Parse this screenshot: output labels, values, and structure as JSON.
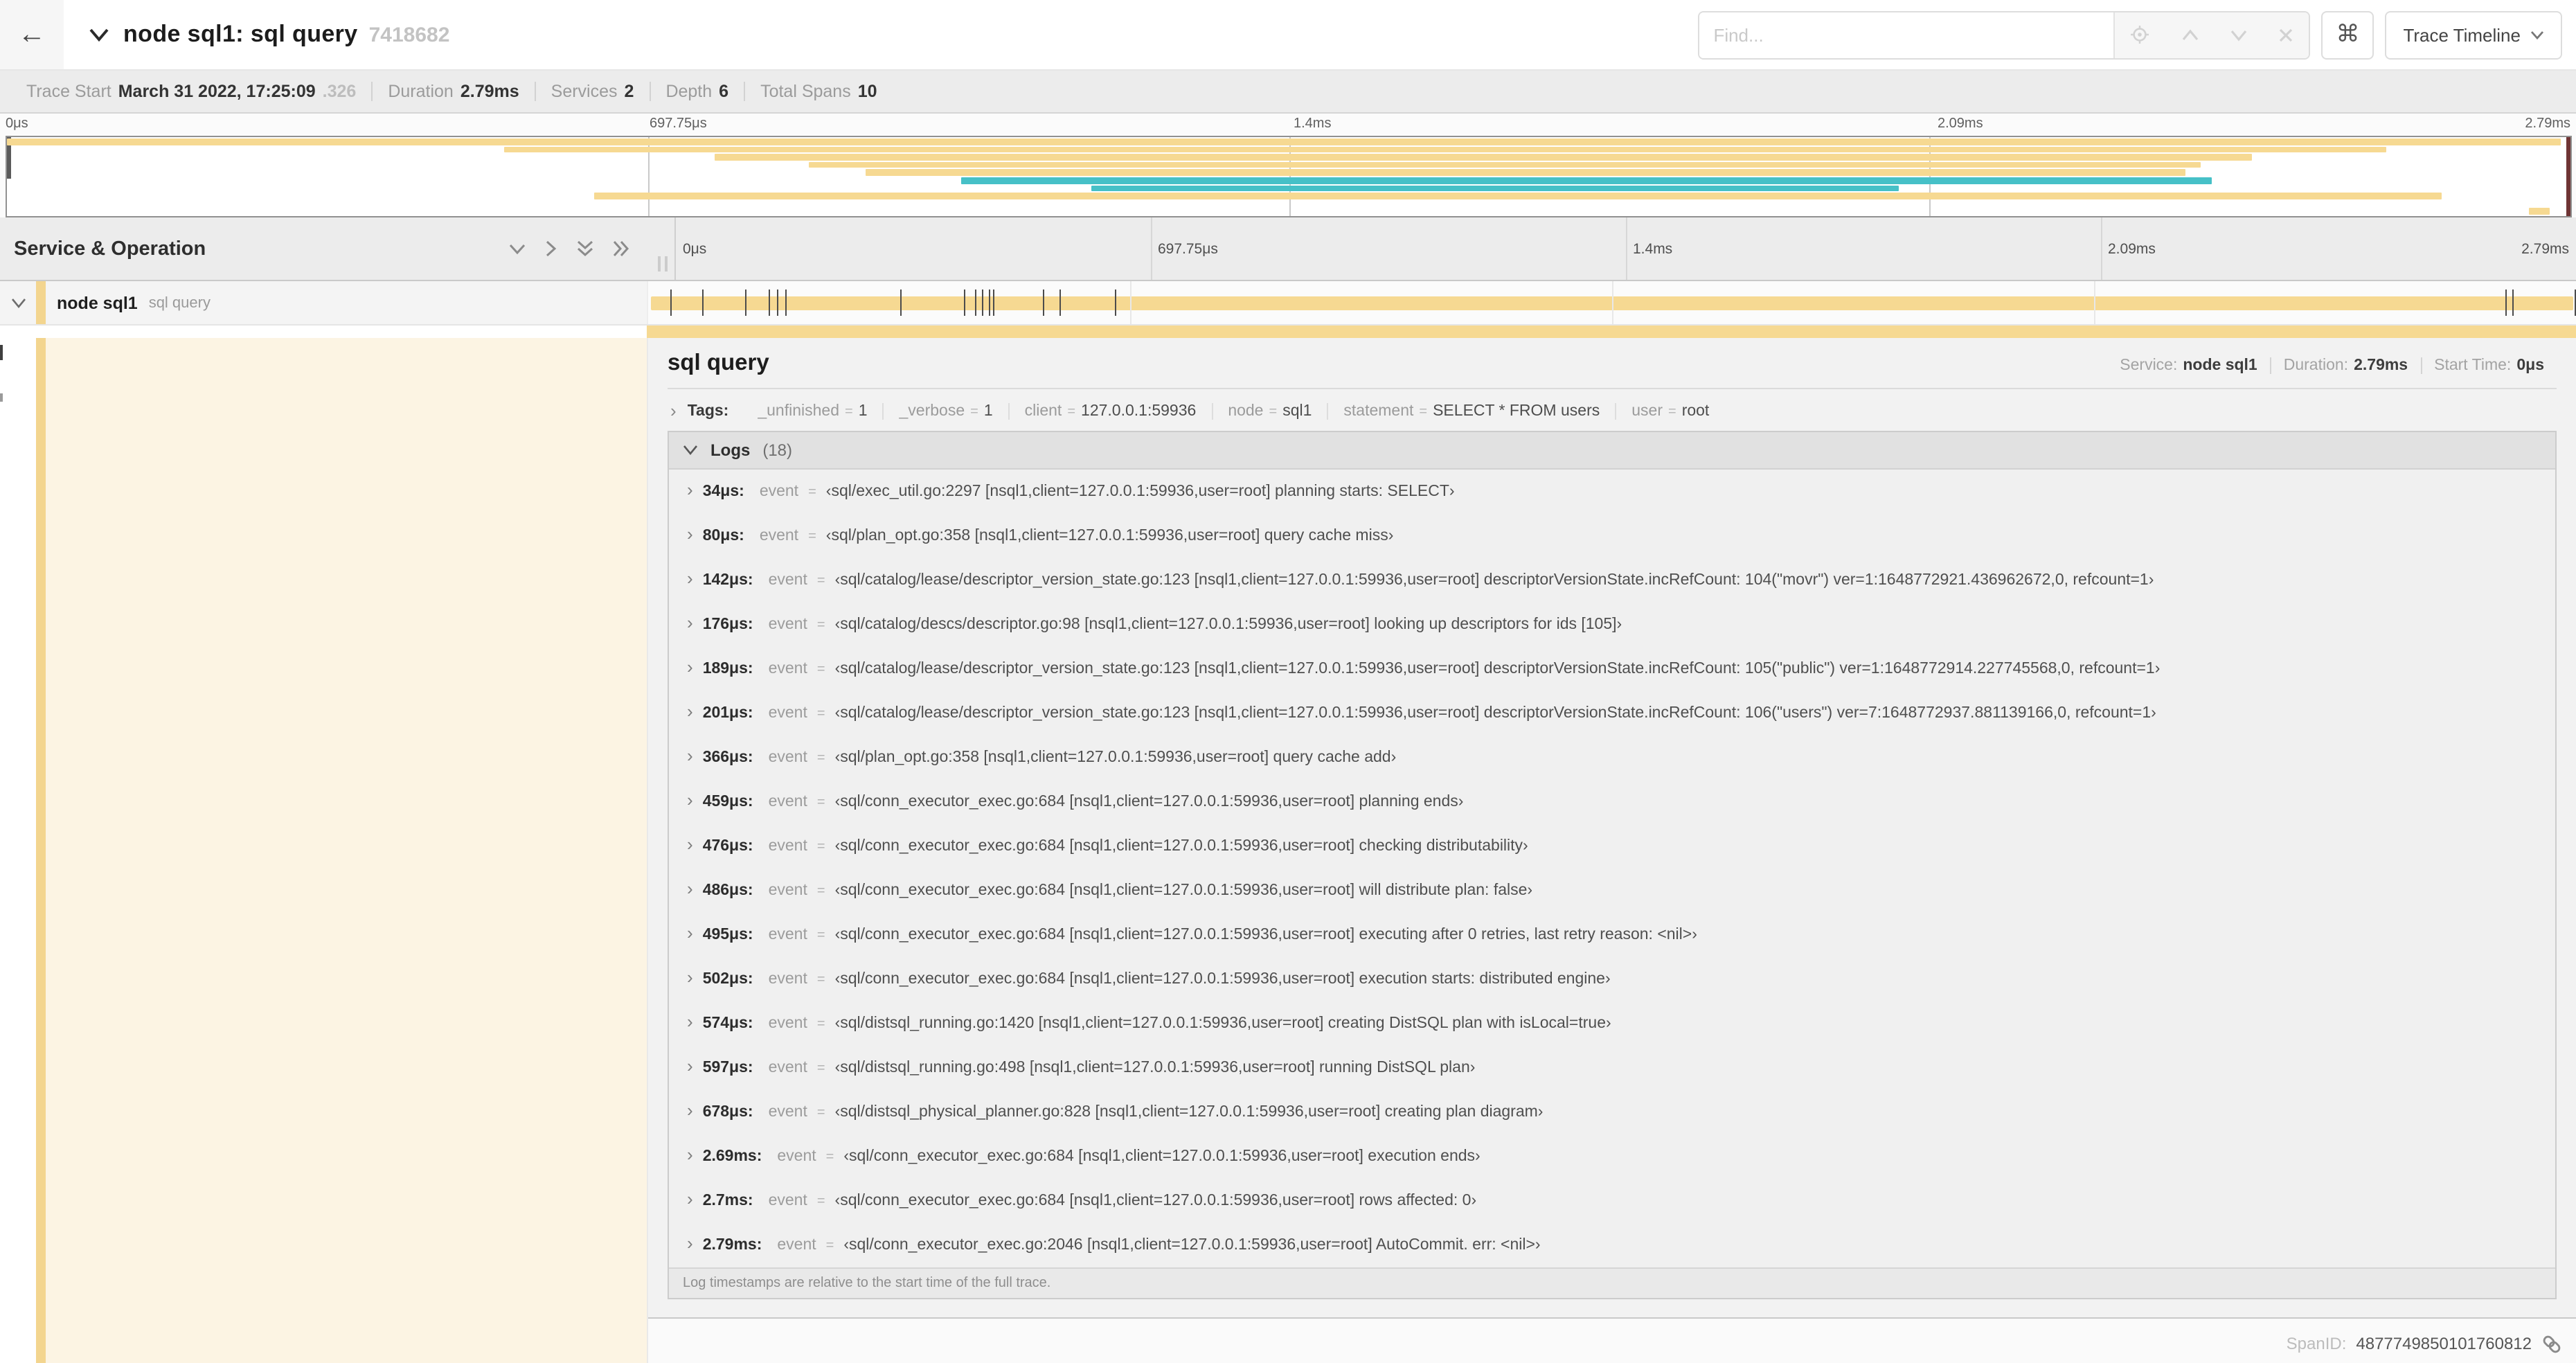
{
  "header": {
    "title": "node sql1: sql query",
    "trace_id": "7418682",
    "find_placeholder": "Find...",
    "shortcut_glyph": "⌘",
    "view_selector": "Trace Timeline",
    "back_glyph": "←"
  },
  "icons": {
    "back": "arrow-left",
    "title_caret": "chevron-down",
    "locate": "crosshair",
    "prev_result": "chevron-up",
    "next_result": "chevron-down",
    "clear": "x",
    "shortcut": "command-key",
    "view_caret": "chevron-down",
    "collapse_one": "chevron-down",
    "expand_one": "chevron-right",
    "collapse_all": "double-chevron-down",
    "expand_all": "double-chevron-right",
    "span_link": "chain-link"
  },
  "summary": {
    "items": [
      {
        "label": "Trace Start",
        "value": "March 31 2022, 17:25:09",
        "suffix": ".326"
      },
      {
        "label": "Duration",
        "value": "2.79ms"
      },
      {
        "label": "Services",
        "value": "2"
      },
      {
        "label": "Depth",
        "value": "6"
      },
      {
        "label": "Total Spans",
        "value": "10"
      }
    ]
  },
  "timeline": {
    "column_header": "Service & Operation",
    "ticks": [
      "0μs",
      "697.75μs",
      "1.4ms",
      "2.09ms",
      "2.79ms"
    ],
    "tick_positions": [
      0,
      25,
      50,
      75,
      100
    ],
    "grid_positions": [
      25,
      50,
      75
    ],
    "duration_us": 2790,
    "minimap_spans": [
      {
        "row": 1,
        "start": 0,
        "end": 99.6,
        "color": "tan"
      },
      {
        "row": 2,
        "start": 19.4,
        "end": 92.8,
        "color": "tan"
      },
      {
        "row": 3,
        "start": 27.6,
        "end": 87.6,
        "color": "tan"
      },
      {
        "row": 4,
        "start": 31.3,
        "end": 85.6,
        "color": "tan"
      },
      {
        "row": 5,
        "start": 33.5,
        "end": 85.0,
        "color": "tan"
      },
      {
        "row": 6,
        "start": 37.2,
        "end": 86.0,
        "color": "teal"
      },
      {
        "row": 7,
        "start": 42.3,
        "end": 73.8,
        "color": "teal"
      },
      {
        "row": 8,
        "start": 22.9,
        "end": 95.0,
        "color": "tan"
      },
      {
        "row": 10,
        "start": 98.4,
        "end": 99.2,
        "color": "tan"
      }
    ]
  },
  "span_row": {
    "service": "node sql1",
    "operation": "sql query",
    "log_marks_us": [
      34,
      80,
      142,
      176,
      189,
      201,
      366,
      459,
      476,
      486,
      495,
      502,
      574,
      597,
      678,
      2690,
      2700,
      2790
    ]
  },
  "detail": {
    "title": "sql query",
    "meta": [
      {
        "label": "Service:",
        "value": "node sql1"
      },
      {
        "label": "Duration:",
        "value": "2.79ms"
      },
      {
        "label": "Start Time:",
        "value": "0μs"
      }
    ],
    "tags_label": "Tags:",
    "tags": [
      {
        "key": "_unfinished",
        "value": "1"
      },
      {
        "key": "_verbose",
        "value": "1"
      },
      {
        "key": "client",
        "value": "127.0.0.1:59936"
      },
      {
        "key": "node",
        "value": "sql1"
      },
      {
        "key": "statement",
        "value": "SELECT * FROM users"
      },
      {
        "key": "user",
        "value": "root"
      }
    ],
    "logs_label": "Logs",
    "logs_count_display": "(18)",
    "logs": [
      {
        "time": "34μs:",
        "key": "event",
        "value": "‹sql/exec_util.go:2297 [nsql1,client=127.0.0.1:59936,user=root] planning starts: SELECT›"
      },
      {
        "time": "80μs:",
        "key": "event",
        "value": "‹sql/plan_opt.go:358 [nsql1,client=127.0.0.1:59936,user=root] query cache miss›"
      },
      {
        "time": "142μs:",
        "key": "event",
        "value": "‹sql/catalog/lease/descriptor_version_state.go:123 [nsql1,client=127.0.0.1:59936,user=root] descriptorVersionState.incRefCount: 104(\"movr\") ver=1:1648772921.436962672,0, refcount=1›"
      },
      {
        "time": "176μs:",
        "key": "event",
        "value": "‹sql/catalog/descs/descriptor.go:98 [nsql1,client=127.0.0.1:59936,user=root] looking up descriptors for ids [105]›"
      },
      {
        "time": "189μs:",
        "key": "event",
        "value": "‹sql/catalog/lease/descriptor_version_state.go:123 [nsql1,client=127.0.0.1:59936,user=root] descriptorVersionState.incRefCount: 105(\"public\") ver=1:1648772914.227745568,0, refcount=1›"
      },
      {
        "time": "201μs:",
        "key": "event",
        "value": "‹sql/catalog/lease/descriptor_version_state.go:123 [nsql1,client=127.0.0.1:59936,user=root] descriptorVersionState.incRefCount: 106(\"users\") ver=7:1648772937.881139166,0, refcount=1›"
      },
      {
        "time": "366μs:",
        "key": "event",
        "value": "‹sql/plan_opt.go:358 [nsql1,client=127.0.0.1:59936,user=root] query cache add›"
      },
      {
        "time": "459μs:",
        "key": "event",
        "value": "‹sql/conn_executor_exec.go:684 [nsql1,client=127.0.0.1:59936,user=root] planning ends›"
      },
      {
        "time": "476μs:",
        "key": "event",
        "value": "‹sql/conn_executor_exec.go:684 [nsql1,client=127.0.0.1:59936,user=root] checking distributability›"
      },
      {
        "time": "486μs:",
        "key": "event",
        "value": "‹sql/conn_executor_exec.go:684 [nsql1,client=127.0.0.1:59936,user=root] will distribute plan: false›"
      },
      {
        "time": "495μs:",
        "key": "event",
        "value": "‹sql/conn_executor_exec.go:684 [nsql1,client=127.0.0.1:59936,user=root] executing after 0 retries, last retry reason: <nil>›"
      },
      {
        "time": "502μs:",
        "key": "event",
        "value": "‹sql/conn_executor_exec.go:684 [nsql1,client=127.0.0.1:59936,user=root] execution starts: distributed engine›"
      },
      {
        "time": "574μs:",
        "key": "event",
        "value": "‹sql/distsql_running.go:1420 [nsql1,client=127.0.0.1:59936,user=root] creating DistSQL plan with isLocal=true›"
      },
      {
        "time": "597μs:",
        "key": "event",
        "value": "‹sql/distsql_running.go:498 [nsql1,client=127.0.0.1:59936,user=root] running DistSQL plan›"
      },
      {
        "time": "678μs:",
        "key": "event",
        "value": "‹sql/distsql_physical_planner.go:828 [nsql1,client=127.0.0.1:59936,user=root] creating plan diagram›"
      },
      {
        "time": "2.69ms:",
        "key": "event",
        "value": "‹sql/conn_executor_exec.go:684 [nsql1,client=127.0.0.1:59936,user=root] execution ends›"
      },
      {
        "time": "2.7ms:",
        "key": "event",
        "value": "‹sql/conn_executor_exec.go:684 [nsql1,client=127.0.0.1:59936,user=root] rows affected: 0›"
      },
      {
        "time": "2.79ms:",
        "key": "event",
        "value": "‹sql/conn_executor_exec.go:2046 [nsql1,client=127.0.0.1:59936,user=root] AutoCommit. err: <nil>›"
      }
    ],
    "logs_note": "Log timestamps are relative to the start time of the full trace.",
    "spanid_label": "SpanID:",
    "spanid_value": "4877749850101760812"
  },
  "colors": {
    "span": "#F6D992",
    "span_stripe": "#F3D58F",
    "span_faded": "#FCF4E3",
    "teal": "#46C0C7"
  }
}
